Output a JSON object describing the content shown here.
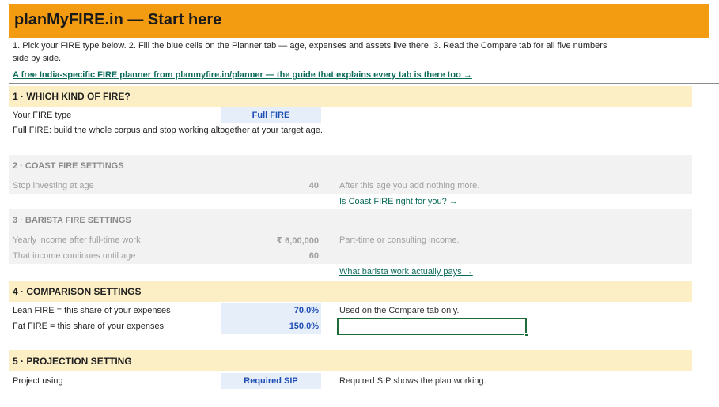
{
  "header": {
    "title": "planMyFIRE.in  —  Start here",
    "steps_line1": "1.  Pick your FIRE type below.    2.  Fill the blue cells on the Planner tab — age, expenses and assets live there.    3.  Read the Compare tab for all five numbers",
    "steps_line2": "side by side.",
    "guide_link": "A free India-specific FIRE planner from planmyfire.in/planner  —  the guide that explains every tab is there too  →"
  },
  "section1": {
    "heading": "1  ·  WHICH KIND OF FIRE?",
    "fire_type_label": "Your FIRE type",
    "fire_type_value": "Full FIRE",
    "description": "Full FIRE: build the whole corpus and stop working altogether at your target age."
  },
  "section2": {
    "heading": "2  ·  COAST FIRE SETTINGS",
    "stop_label": "Stop investing at age",
    "stop_value": "40",
    "stop_note": "After this age you add nothing more.",
    "link": "Is Coast FIRE right for you? →"
  },
  "section3": {
    "heading": "3  ·  BARISTA FIRE SETTINGS",
    "income_label": "Yearly income after full-time work",
    "income_value": "₹ 6,00,000",
    "income_note": "Part-time or consulting income.",
    "until_label": "That income continues until age",
    "until_value": "60",
    "link": "What barista work actually pays →"
  },
  "section4": {
    "heading": "4  ·  COMPARISON SETTINGS",
    "lean_label": "Lean FIRE = this share of your expenses",
    "lean_value": "70.0%",
    "lean_note": "Used on the Compare tab only.",
    "fat_label": "Fat FIRE = this share of your expenses",
    "fat_value": "150.0%"
  },
  "section5": {
    "heading": "5  ·  PROJECTION SETTING",
    "project_label": "Project using",
    "project_value": "Required SIP",
    "project_note": "Required SIP shows the plan working."
  },
  "colors": {
    "title_bar": "#f39c12",
    "section_band": "#fcefc6",
    "disabled_band": "#f2f2f2",
    "input_cell": "#e6eefa",
    "input_text": "#1f4eb4",
    "link": "#0b6b5a",
    "selection": "#1e6b3a"
  }
}
